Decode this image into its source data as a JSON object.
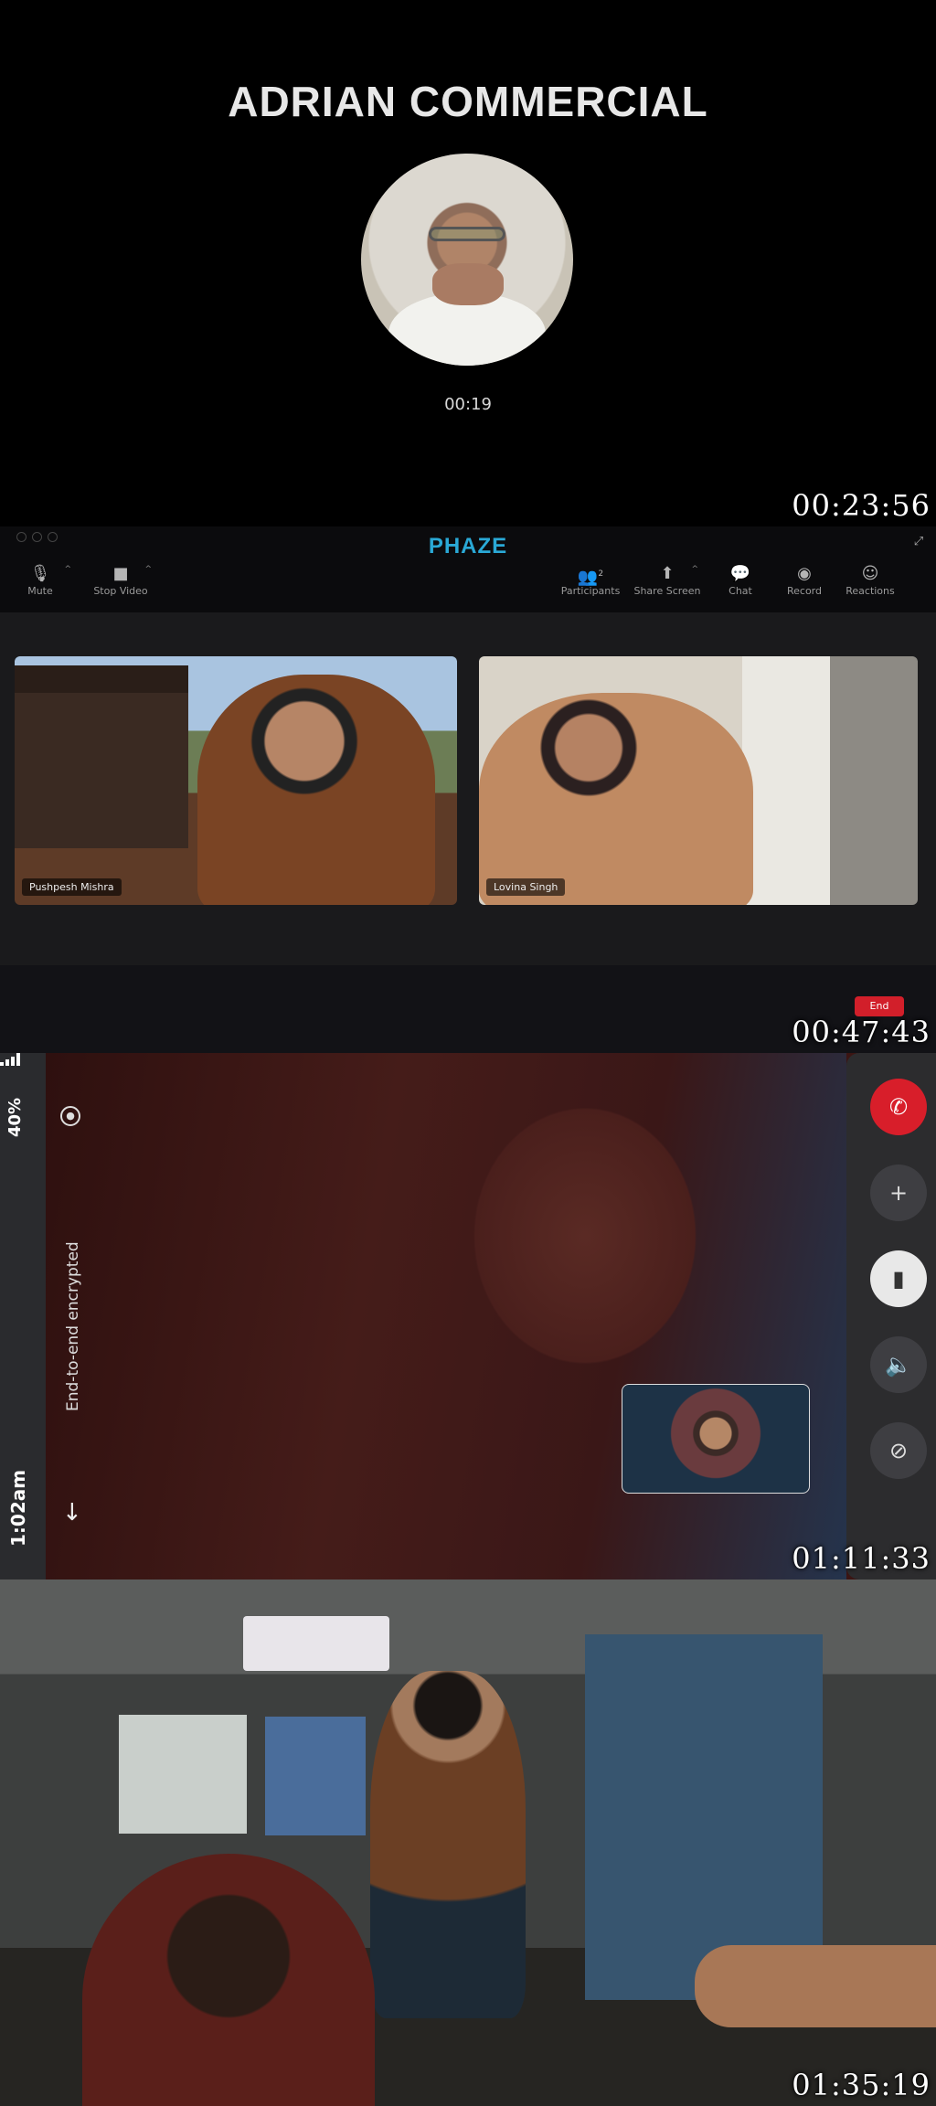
{
  "panel1": {
    "caller_name": "ADRIAN COMMERCIAL",
    "call_duration": "00:19",
    "timestamp": "00:23:56"
  },
  "panel2": {
    "brand": "PHAZE",
    "toolbar": {
      "mute": "Mute",
      "stop_video": "Stop Video",
      "participants": "Participants",
      "participants_count": "2",
      "share_screen": "Share Screen",
      "chat": "Chat",
      "record": "Record",
      "reactions": "Reactions"
    },
    "tiles": [
      {
        "name": "Pushpesh Mishra"
      },
      {
        "name": "Lovina Singh"
      }
    ],
    "end_label": "End",
    "timestamp": "00:47:43"
  },
  "panel3": {
    "battery": "40%",
    "clock": "1:02am",
    "encryption": "End-to-end encrypted",
    "timestamp": "01:11:33"
  },
  "panel4": {
    "timestamp": "01:35:19"
  },
  "icons": {
    "mute": "microphone-icon",
    "video": "video-camera-icon",
    "participants": "people-icon",
    "share": "upload-icon",
    "chat": "chat-bubble-icon",
    "record": "record-icon",
    "reactions": "smiley-icon",
    "end_call": "phone-icon",
    "add": "plus-icon",
    "flip": "flip-camera-icon",
    "speaker": "speaker-icon",
    "camera_off": "camera-off-icon"
  },
  "colors": {
    "brand": "#2aa9d6",
    "end": "#d21f2a"
  }
}
